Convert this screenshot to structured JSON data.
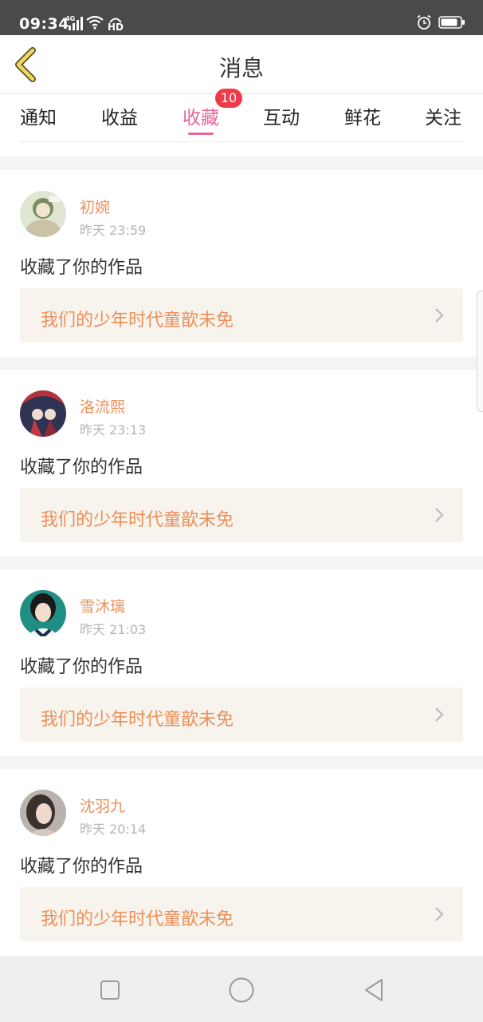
{
  "status_bar": {
    "time": "09:34",
    "network": "4G",
    "hd": "HD"
  },
  "header": {
    "title": "消息"
  },
  "tabs": [
    {
      "label": "通知"
    },
    {
      "label": "收益"
    },
    {
      "label": "收藏",
      "active": true
    },
    {
      "label": "互动"
    },
    {
      "label": "鲜花"
    },
    {
      "label": "关注"
    }
  ],
  "badge": {
    "count": "10"
  },
  "messages": [
    {
      "name": "初婉",
      "time": "昨天 23:59",
      "action": "收藏了你的作品",
      "work": "我们的少年时代童歆未免"
    },
    {
      "name": "洛流熙",
      "time": "昨天 23:13",
      "action": "收藏了你的作品",
      "work": "我们的少年时代童歆未免"
    },
    {
      "name": "雪沐璃",
      "time": "昨天 21:03",
      "action": "收藏了你的作品",
      "work": "我们的少年时代童歆未免"
    },
    {
      "name": "沈羽九",
      "time": "昨天 20:14",
      "action": "收藏了你的作品",
      "work": "我们的少年时代童歆未免"
    }
  ],
  "colors": {
    "accent": "#e8669a",
    "name": "#ee8f5a",
    "badge": "#ee3b48",
    "back_arrow": "#f0d85a"
  }
}
